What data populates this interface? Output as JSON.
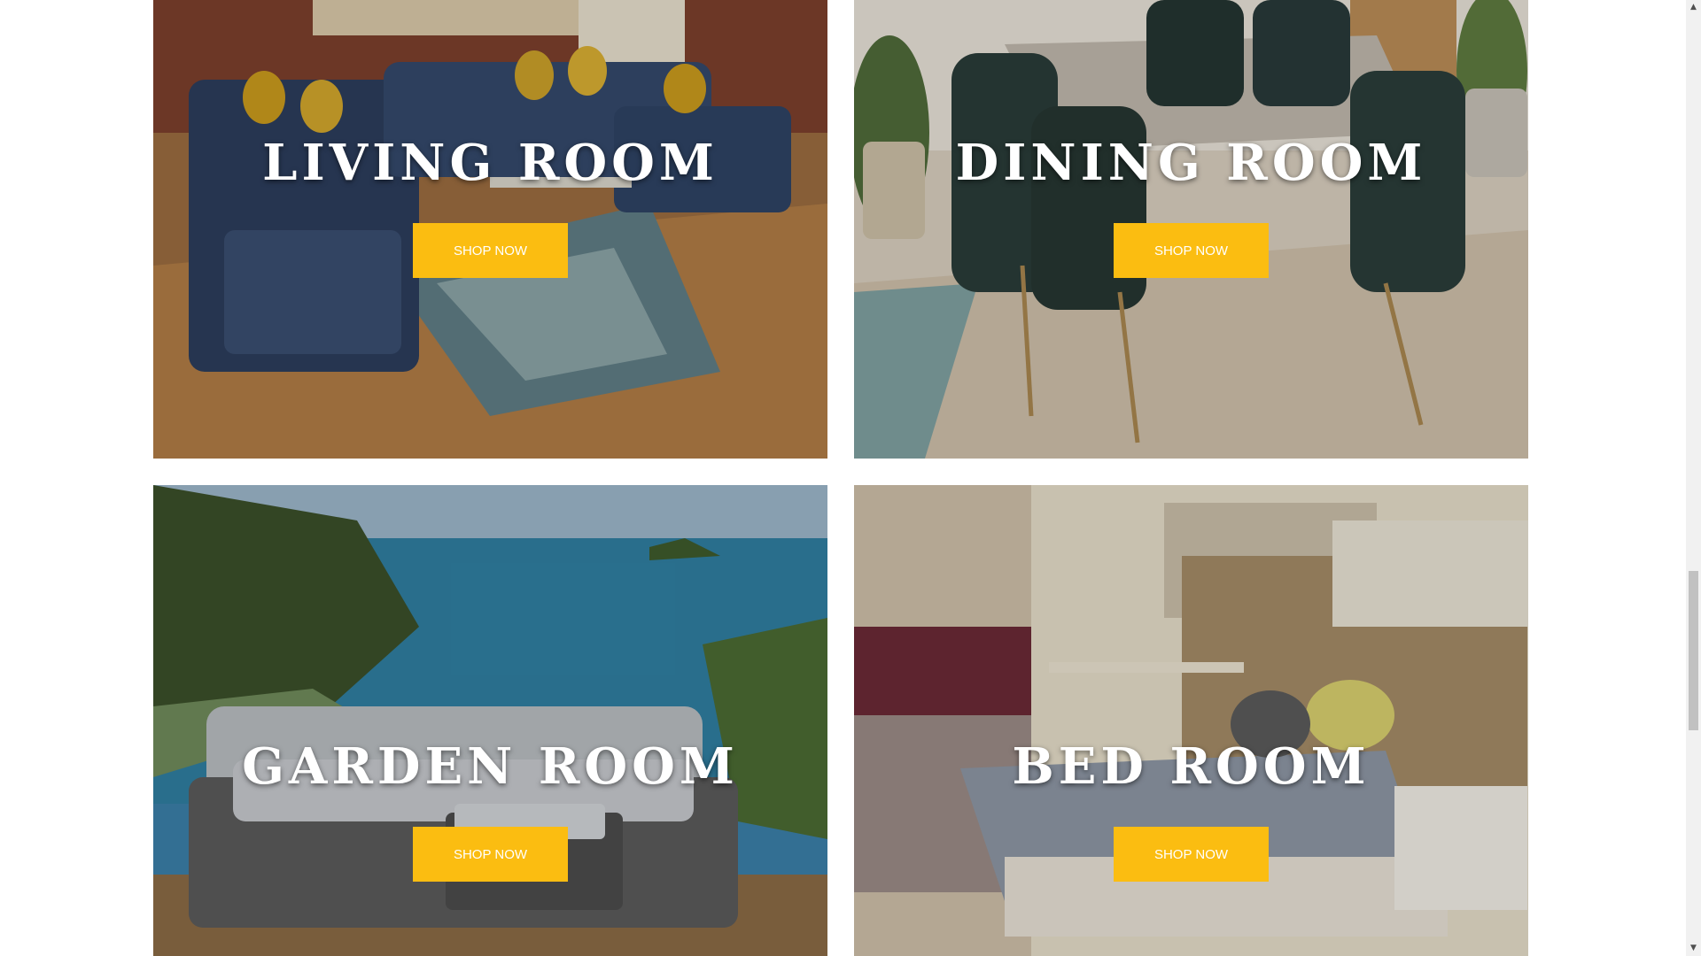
{
  "cards": [
    {
      "title": "LIVING ROOM",
      "button": "SHOP NOW"
    },
    {
      "title": "DINING ROOM",
      "button": "SHOP NOW"
    },
    {
      "title": "GARDEN ROOM",
      "button": "SHOP NOW"
    },
    {
      "title": "BED ROOM",
      "button": "SHOP NOW"
    }
  ],
  "colors": {
    "button_bg": "#fbbd11",
    "button_text": "#ffffff",
    "title_text": "#ffffff"
  },
  "scrollbar": {
    "up_icon": "▲",
    "down_icon": "▼"
  }
}
